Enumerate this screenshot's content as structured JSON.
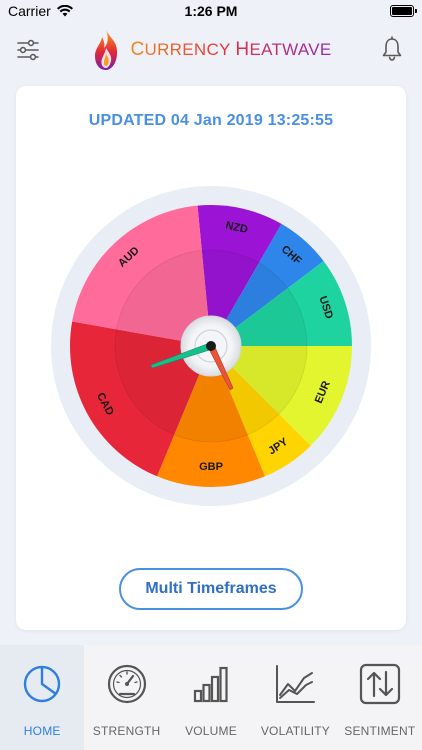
{
  "status_bar": {
    "carrier": "Carrier",
    "time": "1:26 PM",
    "battery_level": 1.0
  },
  "header": {
    "title_first": "C",
    "title_rest": "URRENCY ",
    "title_second": "H",
    "title_rest2": "EATWAVE",
    "left_icon": "filter-sliders-icon",
    "right_icon": "bell-icon",
    "logo_icon": "flame-logo"
  },
  "card": {
    "updated_text": "UPDATED 04 Jan 2019 13:25:55",
    "button_label": "Multi Timeframes"
  },
  "wheel": {
    "segments": [
      {
        "label": "NZD",
        "color": "#9b14d6"
      },
      {
        "label": "CHF",
        "color": "#2f86ea"
      },
      {
        "label": "USD",
        "color": "#1fd3a0"
      },
      {
        "label": "EUR",
        "color": "#e3f52e"
      },
      {
        "label": "JPY",
        "color": "#ffd400"
      },
      {
        "label": "GBP",
        "color": "#ff8800"
      },
      {
        "label": "CAD",
        "color": "#e8263a"
      },
      {
        "label": "AUD",
        "color": "#ff6c9c"
      }
    ]
  },
  "tabs": [
    {
      "label": "HOME",
      "icon": "pie-chart-icon",
      "active": true
    },
    {
      "label": "STRENGTH",
      "icon": "gauge-icon",
      "active": false
    },
    {
      "label": "VOLUME",
      "icon": "bar-chart-icon",
      "active": false
    },
    {
      "label": "VOLATILITY",
      "icon": "line-chart-icon",
      "active": false
    },
    {
      "label": "SENTIMENT",
      "icon": "up-down-arrows-icon",
      "active": false
    }
  ]
}
